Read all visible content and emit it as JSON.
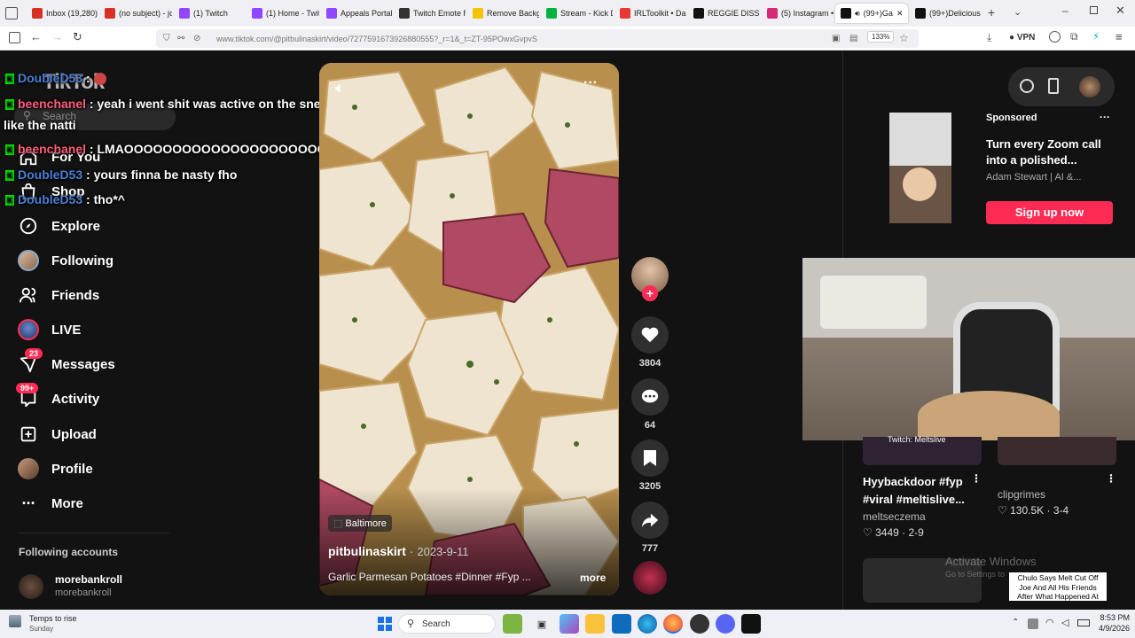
{
  "browser": {
    "tabs": [
      {
        "label": "",
        "color": "#666"
      },
      {
        "label": "Inbox (19,280)",
        "color": "#d93025"
      },
      {
        "label": "(no subject) - jo",
        "color": "#d93025"
      },
      {
        "label": "(1) Twitch",
        "color": "#9146ff"
      },
      {
        "label": "(1) Home - Twit",
        "color": "#9146ff"
      },
      {
        "label": "Appeals Portal",
        "color": "#9146ff"
      },
      {
        "label": "Twitch Emote Resiz",
        "color": "#333"
      },
      {
        "label": "Remove Backgr",
        "color": "#f5c400"
      },
      {
        "label": "Stream - Kick D",
        "color": "#00b341"
      },
      {
        "label": "IRLToolkit • Das",
        "color": "#e53935"
      },
      {
        "label": "REGGIE DISS W",
        "color": "#111"
      },
      {
        "label": "(5) Instagram •",
        "color": "#d62976"
      },
      {
        "label": "(99+)Ga",
        "color": "#111"
      },
      {
        "label": "(99+)Delicious",
        "color": "#111"
      }
    ],
    "url": "www.tiktok.com/@pitbulinaskirt/video/7277591673926880555?_r=1&_t=ZT-95POwxGvpvS",
    "zoom": "133%",
    "vpn": "VPN"
  },
  "chat": [
    {
      "user": "DoubleD53",
      "sep": " : ",
      "msg": "",
      "user_color": "blue"
    },
    {
      "user": "beenchanel",
      "sep": " : ",
      "msg": "yeah i went shit was active on the sneaky but it wasn't live",
      "cont": "like the natti",
      "user_color": "pink"
    },
    {
      "user": "beenchanel",
      "sep": " : ",
      "msg": "LMAOOOOOOOOOOOOOOOOOOOOO",
      "user_color": "pink"
    },
    {
      "user": "DoubleD53",
      "sep": " : ",
      "msg": "yours finna be nasty fho",
      "user_color": "blue"
    },
    {
      "user": "DoubleD53",
      "sep": " : ",
      "msg": "tho*^",
      "user_color": "blue"
    }
  ],
  "sidebar": {
    "search_placeholder": "Search",
    "for_you": "For You",
    "shop": "Shop",
    "items": [
      {
        "label": "Explore",
        "icon": "compass-icon"
      },
      {
        "label": "Following",
        "icon": "following-avatar"
      },
      {
        "label": "Friends",
        "icon": "friends-icon"
      },
      {
        "label": "LIVE",
        "icon": "live-avatar"
      },
      {
        "label": "Messages",
        "icon": "messages-icon",
        "badge": "23"
      },
      {
        "label": "Activity",
        "icon": "activity-icon",
        "badge": "99+"
      },
      {
        "label": "Upload",
        "icon": "upload-icon"
      },
      {
        "label": "Profile",
        "icon": "profile-avatar"
      },
      {
        "label": "More",
        "icon": "more-icon"
      }
    ],
    "following_accounts_title": "Following accounts",
    "following_accounts": [
      {
        "name": "morebankroll",
        "handle": "morebankroll"
      }
    ]
  },
  "video": {
    "location": "Baltimore",
    "author": "pitbulinaskirt",
    "date": "2023-9-11",
    "caption": "Garlic Parmesan Potatoes #Dinner #Fyp ...",
    "more": "more",
    "likes": "3804",
    "comments": "64",
    "saves": "3205",
    "shares": "777"
  },
  "right_panel": {
    "sponsored": {
      "tag": "Sponsored",
      "title": "Turn every Zoom call into a polished...",
      "advertiser": "Adam Stewart | AI &...",
      "cta": "Sign up now"
    },
    "cards": [
      {
        "title": "Hyybackdoor #fyp #viral #meltislive...",
        "author": "meltseczema",
        "likes": "3449",
        "date": "2-9",
        "thumb_text": "Twitch: Meltslive"
      },
      {
        "title": "",
        "author": "clipgrimes",
        "likes": "130.5K",
        "date": "3-4"
      }
    ],
    "watermark": "Activate Windows",
    "watermark_sub": "Go to Settings to activate Windows.",
    "overlay_caption": "Chulo Says Melt Cut Off Joe And All His Friends After What Happened At"
  },
  "taskbar": {
    "weather": "Temps to rise",
    "weather_sub": "Sunday",
    "search": "Search",
    "time": "8:53 PM",
    "date": "4/9/2026"
  },
  "colors": {
    "accent": "#fe2c55",
    "background": "#121212"
  }
}
